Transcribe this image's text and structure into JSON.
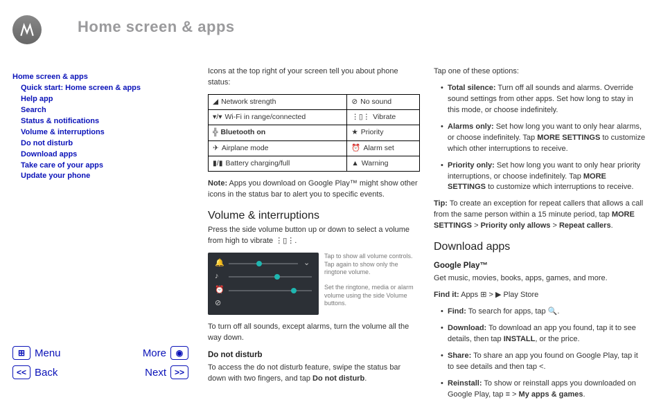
{
  "page_title": "Home screen & apps",
  "toc": {
    "root": "Home screen & apps",
    "items": [
      "Quick start: Home screen & apps",
      "Help app",
      "Search",
      "Status & notifications",
      "Volume & interruptions",
      "Do not disturb",
      "Download apps",
      "Take care of your apps",
      "Update your phone"
    ]
  },
  "nav": {
    "menu": "Menu",
    "more": "More",
    "back": "Back",
    "next": "Next"
  },
  "col1": {
    "intro": "Icons at the top right of your screen tell you about phone status:",
    "table": {
      "r0": {
        "a": "Network strength",
        "b": "No sound"
      },
      "r1": {
        "a": "Wi-Fi in range/connected",
        "b": "Vibrate"
      },
      "r2": {
        "a": "Bluetooth on",
        "b": "Priority"
      },
      "r3": {
        "a": "Airplane mode",
        "b": "Alarm set"
      },
      "r4": {
        "a": "Battery charging/full",
        "b": "Warning"
      }
    },
    "note_label": "Note:",
    "note_text": " Apps you download on Google Play™ might show other icons in the status bar to alert you to specific events.",
    "h_volume": "Volume & interruptions",
    "vol_p1": "Press the side volume button up or down to select a volume from high to vibrate ",
    "vol_note1": "Tap to show all volume controls. Tap again to show only the ringtone volume.",
    "vol_note2": "Set the ringtone, media or alarm volume using the side Volume buttons.",
    "vol_p2": "To turn off all sounds, except alarms, turn the volume all the way down.",
    "h_dnd": "Do not disturb",
    "dnd_p_a": "To access the do not disturb feature, swipe the status bar down with two fingers, and tap ",
    "dnd_p_b": "Do not disturb",
    "dnd_p_c": "."
  },
  "col2": {
    "tap_intro": "Tap one of these options:",
    "opt1_label": "Total silence:",
    "opt1_text": " Turn off all sounds and alarms. Override sound settings from other apps. Set how long to stay in this mode, or choose indefinitely.",
    "opt2_label": "Alarms only:",
    "opt2_text_a": " Set how long you want to only hear alarms, or choose indefinitely. Tap ",
    "opt2_ms": "MORE SETTINGS",
    "opt2_text_b": " to customize which other interruptions to receive.",
    "opt3_label": "Priority only:",
    "opt3_text_a": " Set how long you want to only hear priority interruptions, or choose indefinitely. Tap ",
    "opt3_ms": "MORE SETTINGS",
    "opt3_text_b": " to customize which interruptions to receive.",
    "tip_label": "Tip:",
    "tip_text_a": " To create an exception for repeat callers that allows a call from the same person within a 15 minute period, tap ",
    "tip_path1": "MORE SETTINGS",
    "tip_gt1": " > ",
    "tip_path2": "Priority only allows",
    "tip_gt2": " > ",
    "tip_path3": "Repeat callers",
    "tip_end": ".",
    "h_download": "Download apps",
    "h_gplay": "Google Play™",
    "gplay_p": "Get music, movies, books, apps, games, and more.",
    "findit_label": "Find it:",
    "findit_a": " Apps ",
    "findit_b": " > ",
    "findit_c": " Play Store",
    "b1_label": "Find:",
    "b1_text": " To search for apps, tap ",
    "b2_label": "Download:",
    "b2_text_a": " To download an app you found, tap it to see details, then tap ",
    "b2_install": "INSTALL",
    "b2_text_b": ", or the price.",
    "b3_label": "Share:",
    "b3_text_a": " To share an app you found on Google Play, tap it to see details and then tap ",
    "b4_label": "Reinstall:",
    "b4_text_a": " To show or reinstall apps you downloaded on Google Play, tap ",
    "b4_text_b": " > ",
    "b4_path": "My apps & games",
    "b4_end": "."
  }
}
